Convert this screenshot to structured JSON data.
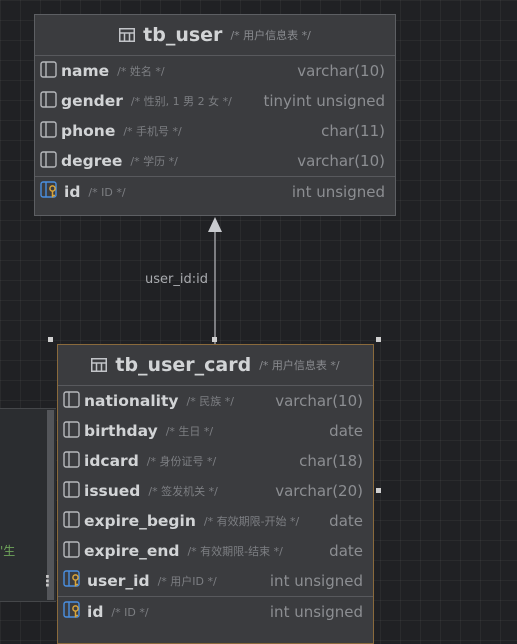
{
  "tables": {
    "user": {
      "name": "tb_user",
      "comment": "/* 用户信息表 */",
      "columns": [
        {
          "name": "name",
          "comment": "/* 姓名 */",
          "type": "varchar(10)"
        },
        {
          "name": "gender",
          "comment": "/* 性别, 1 男  2 女 */",
          "type": "tinyint unsigned"
        },
        {
          "name": "phone",
          "comment": "/* 手机号 */",
          "type": "char(11)"
        },
        {
          "name": "degree",
          "comment": "/* 学历 */",
          "type": "varchar(10)"
        }
      ],
      "keys": [
        {
          "name": "id",
          "comment": "/* ID */",
          "type": "int unsigned"
        }
      ]
    },
    "card": {
      "name": "tb_user_card",
      "comment": "/* 用户信息表 */",
      "columns": [
        {
          "name": "nationality",
          "comment": "/* 民族 */",
          "type": "varchar(10)"
        },
        {
          "name": "birthday",
          "comment": "/* 生日 */",
          "type": "date"
        },
        {
          "name": "idcard",
          "comment": "/* 身份证号 */",
          "type": "char(18)"
        },
        {
          "name": "issued",
          "comment": "/* 签发机关 */",
          "type": "varchar(20)"
        },
        {
          "name": "expire_begin",
          "comment": "/* 有效期限-开始 */",
          "type": "date"
        },
        {
          "name": "expire_end",
          "comment": "/* 有效期限-结束 */",
          "type": "date"
        },
        {
          "name": "user_id",
          "comment": "/* 用户ID */",
          "type": "int unsigned"
        }
      ],
      "keys": [
        {
          "name": "id",
          "comment": "/* ID */",
          "type": "int unsigned"
        }
      ]
    }
  },
  "relation": {
    "label": "user_id:id"
  },
  "side_panel": {
    "text": "'生",
    "menu_glyph": "⋮"
  },
  "colors": {
    "accent_border": "#8a6a3c",
    "key_icon_blue": "#4a8fe0",
    "key_icon_gold": "#d9a53b"
  },
  "icons": {
    "table": "table-icon",
    "column": "column-icon",
    "foreign_key": "foreign-key-icon",
    "primary_key": "primary-key-icon"
  }
}
